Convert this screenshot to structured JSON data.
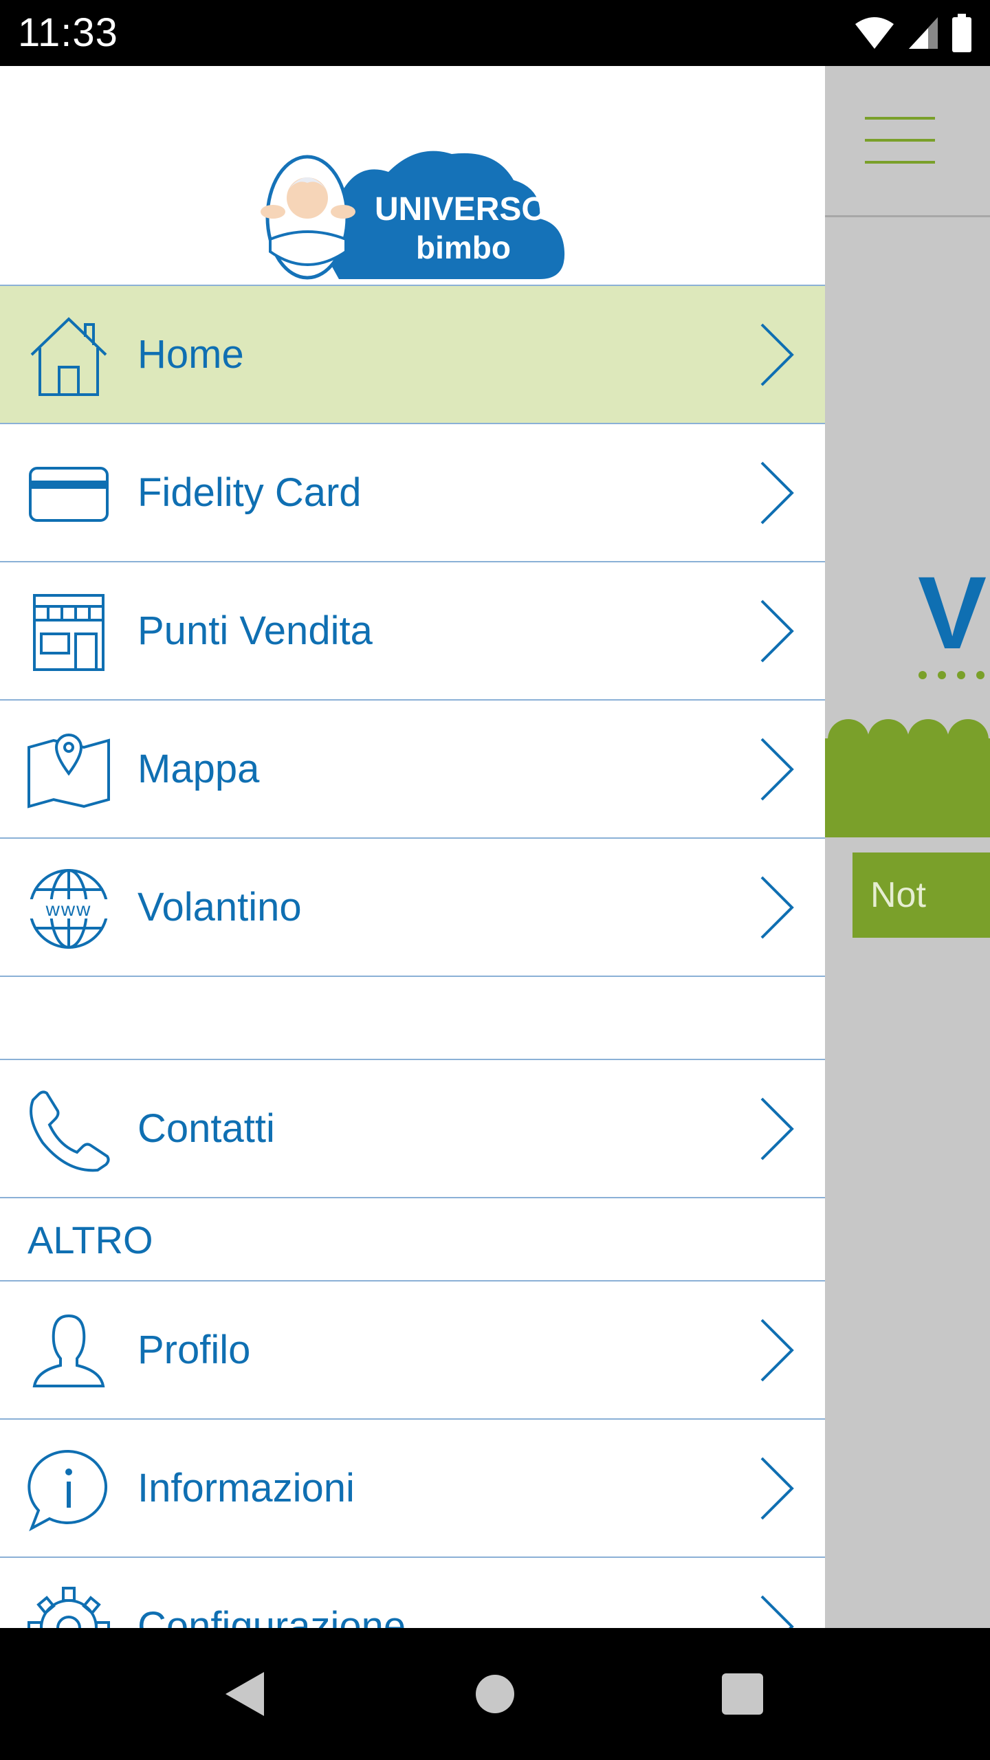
{
  "status_bar": {
    "time": "11:33"
  },
  "drawer": {
    "logo": {
      "line1": "UNIVERSO",
      "line2": "bimbo"
    },
    "items": [
      {
        "label": "Home",
        "icon": "home-icon"
      },
      {
        "label": "Fidelity Card",
        "icon": "card-icon"
      },
      {
        "label": "Punti Vendita",
        "icon": "store-icon"
      },
      {
        "label": "Mappa",
        "icon": "map-icon"
      },
      {
        "label": "Volantino",
        "icon": "globe-icon"
      },
      {
        "label": "Contatti",
        "icon": "phone-icon"
      },
      {
        "label": "Profilo",
        "icon": "user-icon"
      },
      {
        "label": "Informazioni",
        "icon": "info-icon"
      },
      {
        "label": "Configurazione",
        "icon": "gear-icon"
      }
    ],
    "section_altro": "ALTRO",
    "active_item": "Home"
  },
  "background": {
    "heading_partial": "V",
    "button_partial": "Not"
  },
  "colors": {
    "accent_blue": "#0f6fb2",
    "accent_green": "#7aa02a",
    "active_bg": "#dde8bb"
  }
}
